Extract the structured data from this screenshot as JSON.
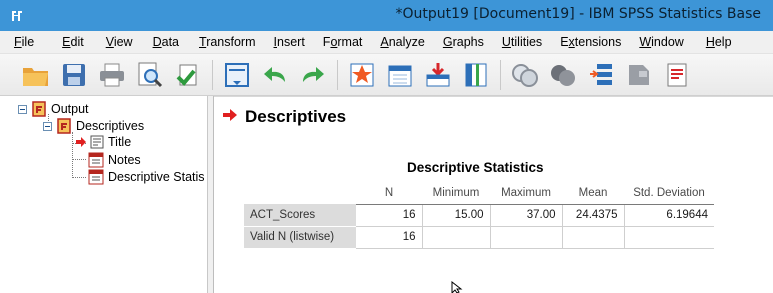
{
  "window": {
    "title": "*Output19 [Document19] - IBM SPSS Statistics Base",
    "accent_color": "#3d95d7"
  },
  "menu": [
    {
      "label": "File",
      "underline": "F",
      "rest": "ile"
    },
    {
      "label": "Edit",
      "underline": "E",
      "rest": "dit"
    },
    {
      "label": "View",
      "underline": "V",
      "rest": "iew"
    },
    {
      "label": "Data",
      "underline": "D",
      "rest": "ata"
    },
    {
      "label": "Transform",
      "underline": "T",
      "rest": "ransform"
    },
    {
      "label": "Insert",
      "underline": "I",
      "rest": "nsert"
    },
    {
      "label": "Format",
      "underline": "o",
      "rest": "Format"
    },
    {
      "label": "Analyze",
      "underline": "A",
      "rest": "nalyze"
    },
    {
      "label": "Graphs",
      "underline": "G",
      "rest": "raphs"
    },
    {
      "label": "Utilities",
      "underline": "U",
      "rest": "tilities"
    },
    {
      "label": "Extensions",
      "underline": "x",
      "rest": "Extensions"
    },
    {
      "label": "Window",
      "underline": "W",
      "rest": "indow"
    },
    {
      "label": "Help",
      "underline": "H",
      "rest": "elp"
    }
  ],
  "toolbar": {
    "buttons": [
      "open-folder-icon",
      "save-icon",
      "print-icon",
      "print-preview-icon",
      "export-icon",
      "recall-dialog-icon",
      "undo-icon",
      "redo-icon",
      "goto-data-icon",
      "goto-case-icon",
      "insert-cases-icon",
      "insert-variables-icon",
      "split-file-icon",
      "weight-cases-icon",
      "select-cases-icon",
      "value-labels-icon",
      "use-variable-sets-icon"
    ]
  },
  "outline": {
    "root": "Output",
    "procedure": "Descriptives",
    "items": [
      "Title",
      "Notes",
      "Descriptive Statis"
    ]
  },
  "content": {
    "heading": "Descriptives",
    "table": {
      "title": "Descriptive Statistics",
      "columns": [
        "N",
        "Minimum",
        "Maximum",
        "Mean",
        "Std. Deviation"
      ],
      "rows": [
        {
          "label": "ACT_Scores",
          "values": [
            "16",
            "15.00",
            "37.00",
            "24.4375",
            "6.19644"
          ]
        },
        {
          "label": "Valid N (listwise)",
          "values": [
            "16",
            "",
            "",
            "",
            ""
          ]
        }
      ]
    }
  }
}
